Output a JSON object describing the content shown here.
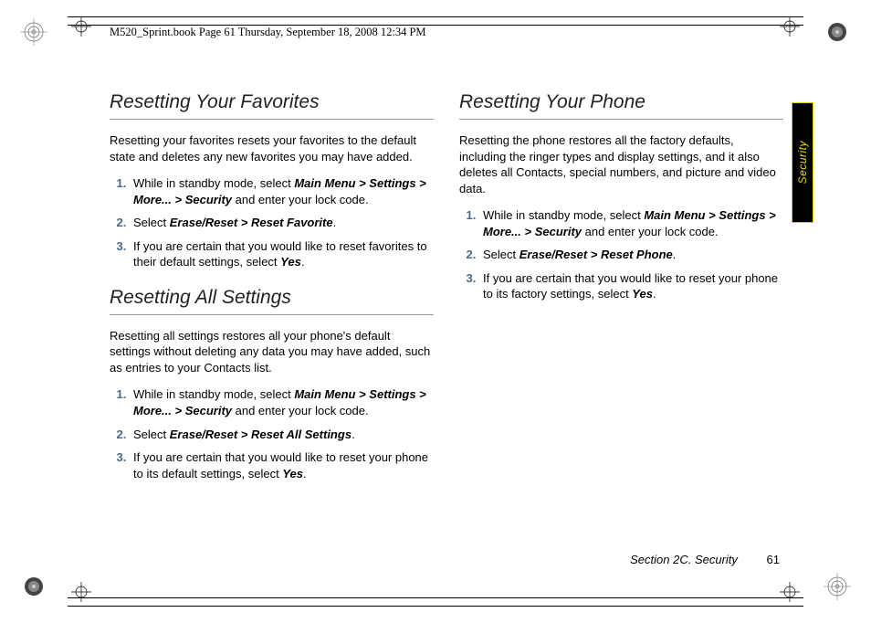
{
  "header": {
    "text": "M520_Sprint.book  Page 61  Thursday, September 18, 2008  12:34 PM"
  },
  "sideTab": {
    "label": "Security"
  },
  "footer": {
    "section": "Section 2C. Security",
    "page": "61"
  },
  "left": {
    "h1": "Resetting Your Favorites",
    "p1": "Resetting your favorites resets your favorites to the default state and deletes any new favorites you may have added.",
    "s1a": "While in standby mode, select ",
    "s1b": "Main Menu > Settings > More... > Security",
    "s1c": " and enter your lock code.",
    "s2a": "Select ",
    "s2b": "Erase/Reset > Reset Favorite",
    "s2c": ".",
    "s3a": "If you are certain that you would like to reset favorites to their default settings, select ",
    "s3b": "Yes",
    "s3c": ".",
    "h2": "Resetting All Settings",
    "p2": "Resetting all settings restores all your phone's default settings without deleting any data you may have added, such as entries to your Contacts list.",
    "t1a": "While in standby mode, select ",
    "t1b": "Main Menu > Settings > More... > Security",
    "t1c": " and enter your lock code.",
    "t2a": "Select ",
    "t2b": "Erase/Reset > Reset All Settings",
    "t2c": ".",
    "t3a": "If you are certain that you would like to reset your phone to its default settings, select ",
    "t3b": "Yes",
    "t3c": "."
  },
  "right": {
    "h1": "Resetting Your Phone",
    "p1": "Resetting the phone restores all the factory defaults, including the ringer types and display settings, and it also deletes all Contacts, special numbers, and picture and video data.",
    "s1a": "While in standby mode, select ",
    "s1b": "Main Menu > Settings > More... > Security",
    "s1c": " and enter your lock code.",
    "s2a": "Select ",
    "s2b": "Erase/Reset > Reset Phone",
    "s2c": ".",
    "s3a": "If you are certain that you would like to reset your phone to its factory settings, select ",
    "s3b": "Yes",
    "s3c": "."
  }
}
